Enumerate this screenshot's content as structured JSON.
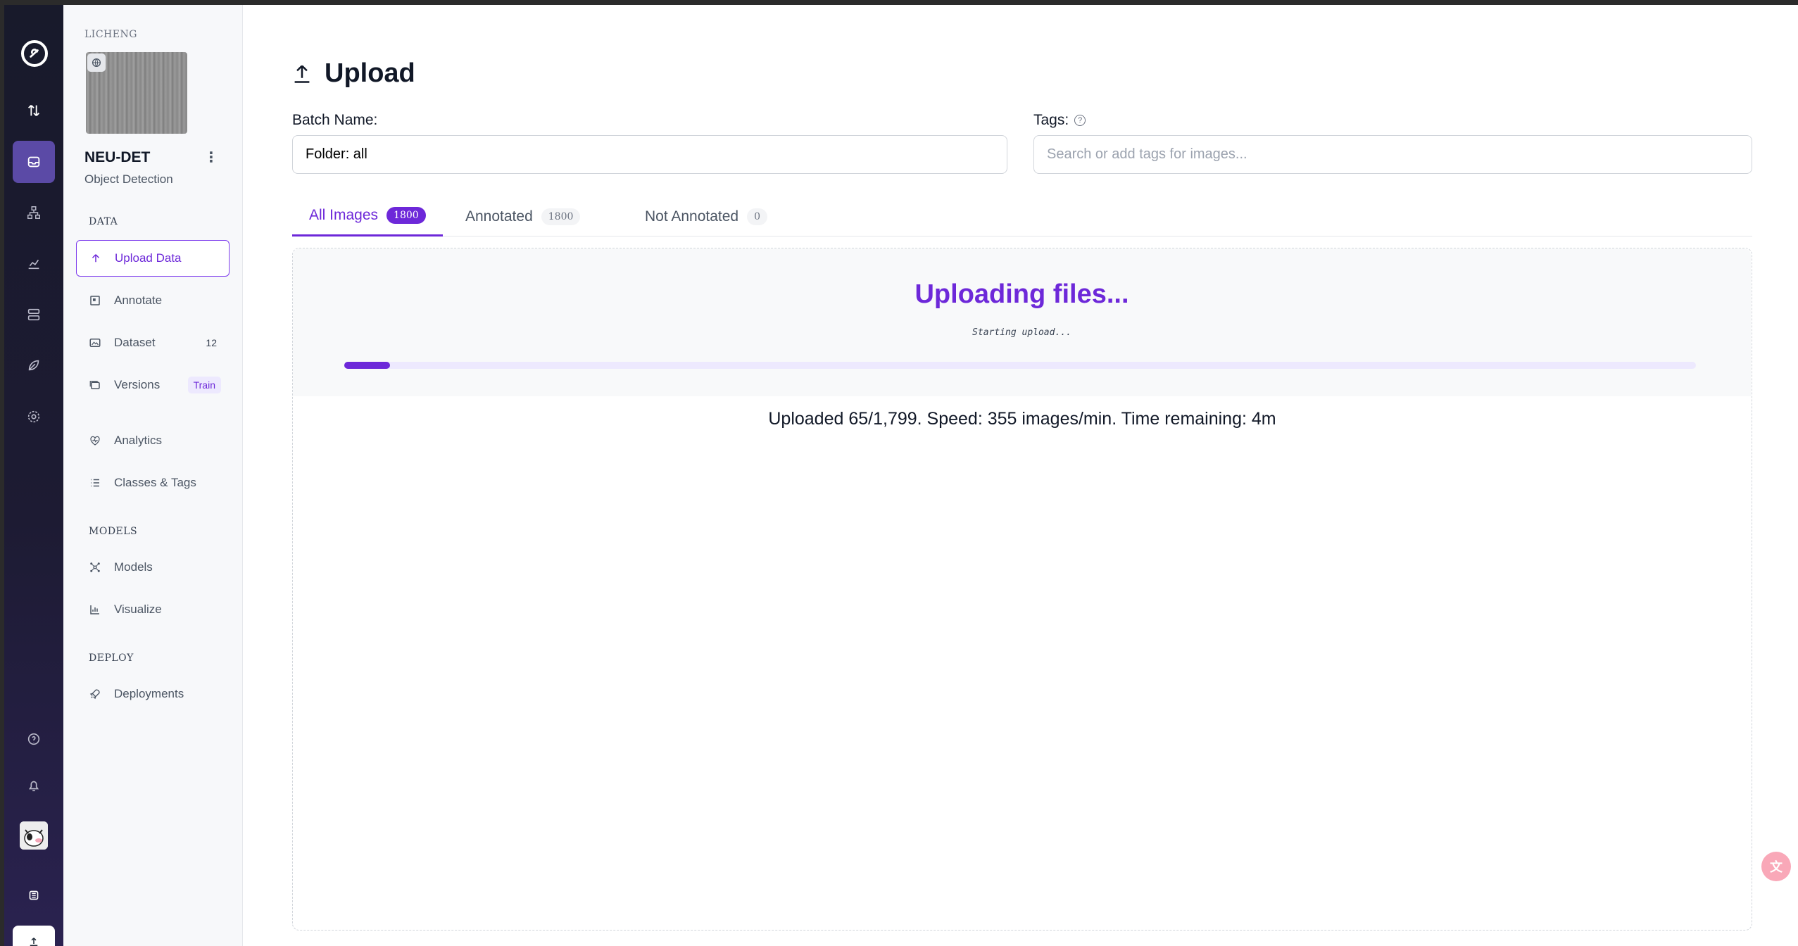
{
  "rail": {
    "icons": [
      "logo-icon",
      "swap-arrows-icon",
      "inbox-icon",
      "hierarchy-icon",
      "chart-icon",
      "server-icon",
      "leaf-icon",
      "gear-icon",
      "help-icon",
      "bell-icon",
      "avatar",
      "stack-icon",
      "upload-icon"
    ]
  },
  "project": {
    "workspace": "LICHENG",
    "name": "NEU-DET",
    "type": "Object Detection"
  },
  "sidebar": {
    "sections": {
      "data": "DATA",
      "models": "MODELS",
      "deploy": "DEPLOY"
    },
    "items": {
      "upload_data": "Upload Data",
      "annotate": "Annotate",
      "dataset": "Dataset",
      "dataset_count": "12",
      "versions": "Versions",
      "versions_badge": "Train",
      "analytics": "Analytics",
      "classes_tags": "Classes & Tags",
      "models": "Models",
      "visualize": "Visualize",
      "deployments": "Deployments"
    }
  },
  "page": {
    "title": "Upload",
    "batch_label": "Batch Name:",
    "batch_value": "Folder: all",
    "tags_label": "Tags:",
    "tags_placeholder": "Search or add tags for images..."
  },
  "tabs": [
    {
      "label": "All Images",
      "count": "1800",
      "active": true
    },
    {
      "label": "Annotated",
      "count": "1800",
      "active": false
    },
    {
      "label": "Not Annotated",
      "count": "0",
      "active": false
    }
  ],
  "upload": {
    "title": "Uploading files...",
    "subtitle": "Starting upload...",
    "progress": 0.034,
    "stats": "Uploaded 65/1,799. Speed: 355 images/min. Time remaining: 4m"
  },
  "colors": {
    "accent": "#6d28d9",
    "rail_active": "#5b4aa6"
  }
}
